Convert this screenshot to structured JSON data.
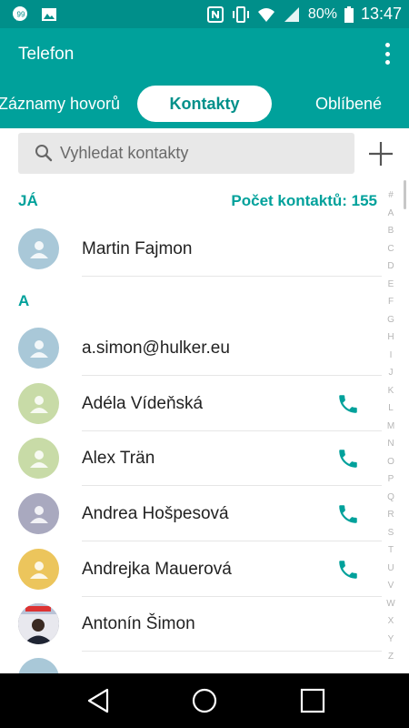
{
  "status_bar": {
    "battery": "80%",
    "time": "13:47",
    "icons": [
      "message-icon",
      "gallery-icon",
      "nfc-icon",
      "vibrate-icon",
      "wifi-icon",
      "signal-icon",
      "battery-icon"
    ]
  },
  "app": {
    "title": "Telefon"
  },
  "tabs": [
    {
      "label": "Záznamy hovorů"
    },
    {
      "label": "Kontakty",
      "active": true
    },
    {
      "label": "Oblíbené"
    }
  ],
  "search": {
    "placeholder": "Vyhledat kontakty"
  },
  "me_section": {
    "label": "JÁ",
    "count_label": "Počet kontaktů: 155"
  },
  "me_contact": {
    "name": "Martin Fajmon",
    "avatar_color": "#a9c8d8"
  },
  "section_a": {
    "label": "A"
  },
  "contacts": [
    {
      "name": "a.simon@hulker.eu",
      "avatar_color": "#a9c8d8",
      "has_call": false
    },
    {
      "name": "Adéla Vídeňská",
      "avatar_color": "#c8dba7",
      "has_call": true
    },
    {
      "name": "Alex Trän",
      "avatar_color": "#c8dba7",
      "has_call": true
    },
    {
      "name": "Andrea Hošpesová",
      "avatar_color": "#a9a9bf",
      "has_call": true
    },
    {
      "name": "Andrejka Mauerová",
      "avatar_color": "#ecc55c",
      "has_call": true
    },
    {
      "name": "Antonín Šimon",
      "avatar_color": "photo",
      "has_call": false
    }
  ],
  "alphabet": [
    "#",
    "A",
    "B",
    "C",
    "D",
    "E",
    "F",
    "G",
    "H",
    "I",
    "J",
    "K",
    "L",
    "M",
    "N",
    "O",
    "P",
    "Q",
    "R",
    "S",
    "T",
    "U",
    "V",
    "W",
    "X",
    "Y",
    "Z"
  ],
  "colors": {
    "primary": "#00a19b",
    "status_bar": "#008f8a"
  }
}
